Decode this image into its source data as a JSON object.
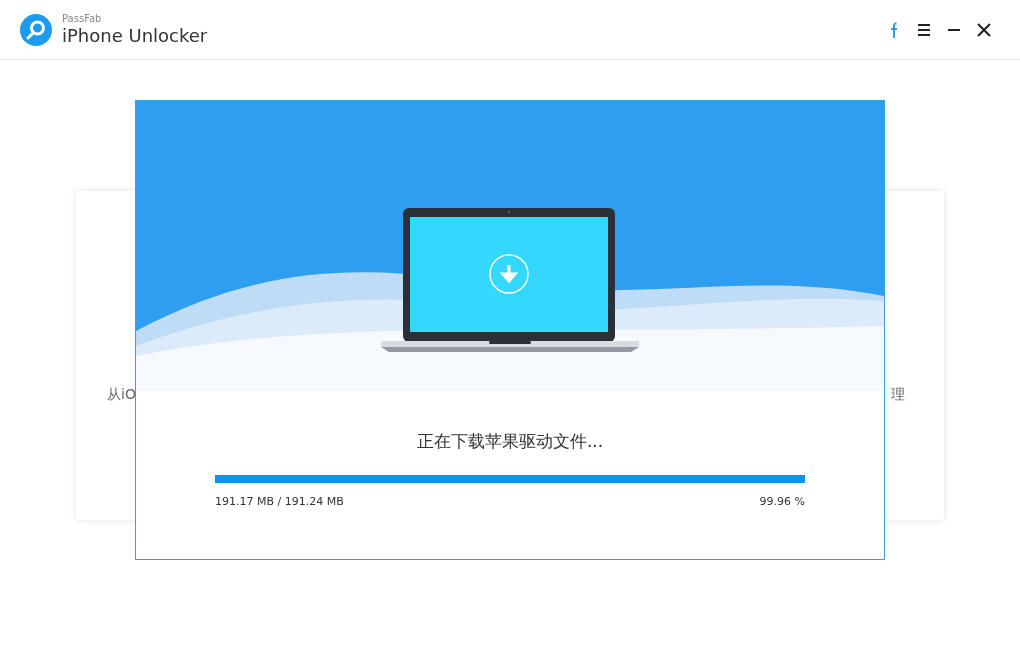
{
  "window": {
    "brand": "PassFab",
    "title": "iPhone Unlocker"
  },
  "background_card": {
    "left_text": "从iO",
    "right_text": "理"
  },
  "dialog": {
    "message": "正在下载苹果驱动文件...",
    "level": 0.9996,
    "size": "191.17 MB / 191.24 MB",
    "percent": "99.96 %"
  }
}
